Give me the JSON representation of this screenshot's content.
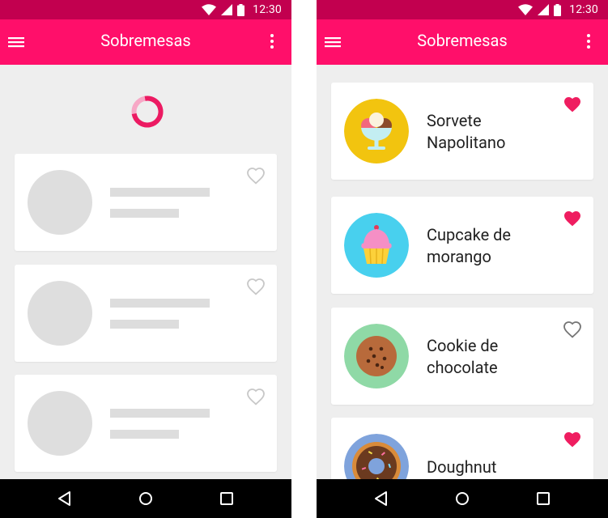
{
  "colors": {
    "status_bar": "#c2004f",
    "app_bar": "#ff0f6a",
    "accent_heart": "#ef1d60",
    "heart_outline": "#757575",
    "skeleton_heart": "#c8c8c8",
    "skeleton": "#dddddd",
    "background": "#eeeeee"
  },
  "status_bar": {
    "time": "12:30",
    "icons": [
      "wifi-icon",
      "signal-icon",
      "battery-icon"
    ]
  },
  "app_bar": {
    "title": "Sobremesas",
    "nav_icon": "menu-icon",
    "action_icon": "more-vert-icon"
  },
  "loading_screen": {
    "spinner": "loading-spinner",
    "placeholder_cards": 3
  },
  "loaded_screen": {
    "items": [
      {
        "name": "Sorvete\nNapolitano",
        "icon": "ice-cream-icon",
        "icon_bg": "#f2c40f",
        "favorite": true
      },
      {
        "name": "Cupcake de\nmorango",
        "icon": "cupcake-icon",
        "icon_bg": "#48d0ee",
        "favorite": true
      },
      {
        "name": "Cookie de\nchocolate",
        "icon": "cookie-icon",
        "icon_bg": "#8fd9a6",
        "favorite": false
      },
      {
        "name": "Doughnut",
        "icon": "doughnut-icon",
        "icon_bg": "#7fa3dc",
        "favorite": true
      }
    ]
  },
  "nav_bar": {
    "buttons": [
      "back-icon",
      "home-icon",
      "recents-icon"
    ]
  }
}
